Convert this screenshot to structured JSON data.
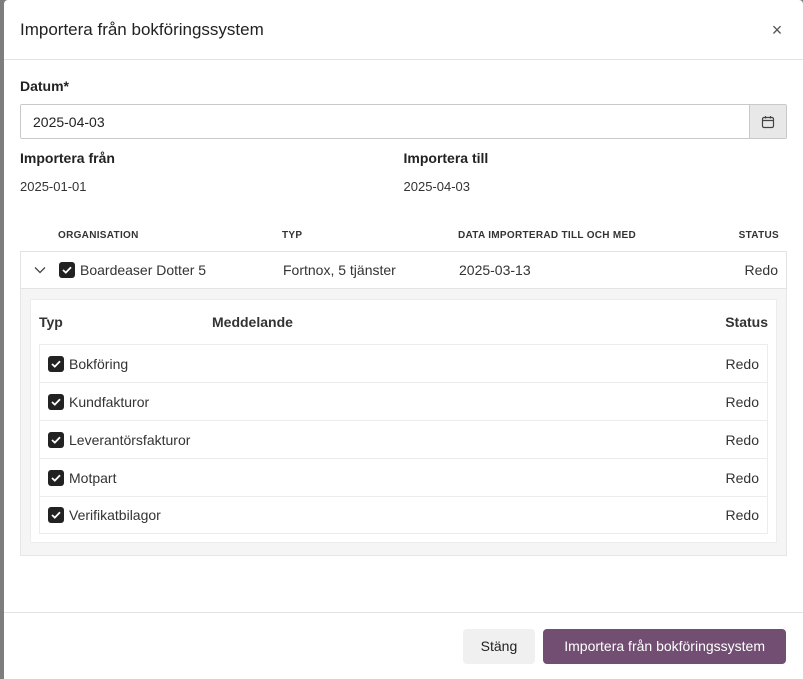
{
  "modal": {
    "title": "Importera från bokföringssystem",
    "close_symbol": "×"
  },
  "form": {
    "date_label": "Datum*",
    "date_value": "2025-04-03",
    "import_from_label": "Importera från",
    "import_from_value": "2025-01-01",
    "import_to_label": "Importera till",
    "import_to_value": "2025-04-03"
  },
  "org_table": {
    "headers": {
      "organisation": "ORGANISATION",
      "typ": "TYP",
      "data_imported": "DATA IMPORTERAD TILL OCH MED",
      "status": "STATUS"
    },
    "rows": [
      {
        "organisation": "Boardeaser Dotter 5",
        "typ": "Fortnox, 5 tjänster",
        "data_imported": "2025-03-13",
        "status": "Redo",
        "checked": true,
        "expanded": true
      }
    ]
  },
  "detail_table": {
    "headers": {
      "typ": "Typ",
      "message": "Meddelande",
      "status": "Status"
    },
    "rows": [
      {
        "label": "Bokföring",
        "status": "Redo",
        "checked": true
      },
      {
        "label": "Kundfakturor",
        "status": "Redo",
        "checked": true
      },
      {
        "label": "Leverantörsfakturor",
        "status": "Redo",
        "checked": true
      },
      {
        "label": "Motpart",
        "status": "Redo",
        "checked": true
      },
      {
        "label": "Verifikatbilagor",
        "status": "Redo",
        "checked": true
      }
    ]
  },
  "footer": {
    "close_label": "Stäng",
    "import_label": "Importera från bokföringssystem"
  },
  "colors": {
    "primary": "#714e72",
    "checkbox": "#222222"
  },
  "icons": {
    "close": "close-icon",
    "calendar": "calendar-icon",
    "chevron": "chevron-down-icon",
    "checkbox": "check-icon"
  }
}
